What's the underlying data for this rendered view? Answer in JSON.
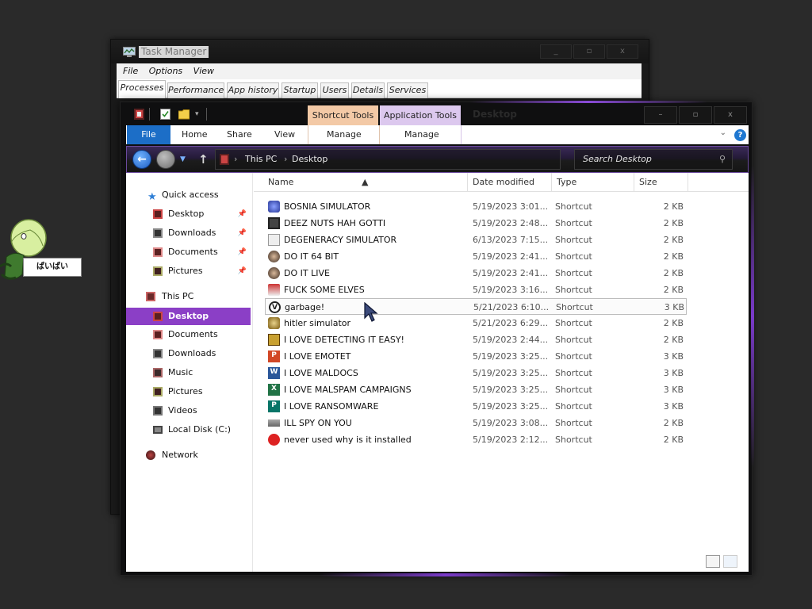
{
  "mascot": {
    "speech": "ぱいぱい"
  },
  "task_manager": {
    "title": "Task Manager",
    "controls": [
      "_",
      "▫",
      "x"
    ],
    "menu": [
      "File",
      "Options",
      "View"
    ],
    "tabs": [
      "Processes",
      "Performance",
      "App history",
      "Startup",
      "Users",
      "Details",
      "Services"
    ],
    "active_tab": "Processes"
  },
  "explorer": {
    "title": "Desktop",
    "contextual_tabs": {
      "shortcut": "Shortcut Tools",
      "application": "Application Tools"
    },
    "window_controls": [
      "–",
      "▫",
      "x"
    ],
    "ribbon_tabs": [
      "File",
      "Home",
      "Share",
      "View",
      "Manage",
      "Manage"
    ],
    "address": {
      "crumbs": [
        "This PC",
        "Desktop"
      ]
    },
    "search": {
      "placeholder": "Search Desktop"
    },
    "nav_pane": {
      "quick_access": {
        "label": "Quick access",
        "items": [
          "Desktop",
          "Downloads",
          "Documents",
          "Pictures"
        ]
      },
      "this_pc": {
        "label": "This PC",
        "items": [
          "Desktop",
          "Documents",
          "Downloads",
          "Music",
          "Pictures",
          "Videos",
          "Local Disk (C:)"
        ]
      },
      "network": {
        "label": "Network"
      },
      "selected": "Desktop"
    },
    "columns": [
      "Name",
      "Date modified",
      "Type",
      "Size"
    ],
    "files": [
      {
        "name": "BOSNIA SIMULATOR",
        "date": "5/19/2023 3:01...",
        "type": "Shortcut",
        "size": "2 KB",
        "icon": "bosnia-icon"
      },
      {
        "name": "DEEZ NUTS HAH GOTTI",
        "date": "5/19/2023 2:48...",
        "type": "Shortcut",
        "size": "2 KB",
        "icon": "app-icon"
      },
      {
        "name": "DEGENERACY SIMULATOR",
        "date": "6/13/2023 7:15...",
        "type": "Shortcut",
        "size": "2 KB",
        "icon": "file-icon"
      },
      {
        "name": "DO IT 64 BIT",
        "date": "5/19/2023 2:41...",
        "type": "Shortcut",
        "size": "2 KB",
        "icon": "face-icon"
      },
      {
        "name": "DO IT LIVE",
        "date": "5/19/2023 2:41...",
        "type": "Shortcut",
        "size": "2 KB",
        "icon": "face-icon"
      },
      {
        "name": "FUCK SOME ELVES",
        "date": "5/19/2023 3:16...",
        "type": "Shortcut",
        "size": "2 KB",
        "icon": "figure-icon"
      },
      {
        "name": "garbage!",
        "date": "5/21/2023 6:10...",
        "type": "Shortcut",
        "size": "3 KB",
        "icon": "vw-icon"
      },
      {
        "name": "hitler simulator",
        "date": "5/21/2023 6:29...",
        "type": "Shortcut",
        "size": "2 KB",
        "icon": "gear-icon"
      },
      {
        "name": "I LOVE DETECTING IT EASY!",
        "date": "5/19/2023 2:44...",
        "type": "Shortcut",
        "size": "2 KB",
        "icon": "die-icon"
      },
      {
        "name": "I LOVE EMOTET",
        "date": "5/19/2023 3:25...",
        "type": "Shortcut",
        "size": "3 KB",
        "icon": "powerpoint-icon"
      },
      {
        "name": "I LOVE MALDOCS",
        "date": "5/19/2023 3:25...",
        "type": "Shortcut",
        "size": "3 KB",
        "icon": "word-icon"
      },
      {
        "name": "I LOVE MALSPAM CAMPAIGNS",
        "date": "5/19/2023 3:25...",
        "type": "Shortcut",
        "size": "3 KB",
        "icon": "excel-icon"
      },
      {
        "name": "I LOVE RANSOMWARE",
        "date": "5/19/2023 3:25...",
        "type": "Shortcut",
        "size": "3 KB",
        "icon": "publisher-icon"
      },
      {
        "name": "ILL SPY ON YOU",
        "date": "5/19/2023 3:08...",
        "type": "Shortcut",
        "size": "2 KB",
        "icon": "spy-icon"
      },
      {
        "name": "never used why is it installed",
        "date": "5/19/2023 2:12...",
        "type": "Shortcut",
        "size": "2 KB",
        "icon": "dev-icon"
      }
    ],
    "hovered_file": "garbage!"
  },
  "colors": {
    "accent_purple": "#8b3fc6",
    "file_tab_blue": "#1c6ec7",
    "shortcut_tools": "#f3c9a6",
    "application_tools": "#dcc8ee",
    "desktop_bg": "#2a2a2a"
  }
}
